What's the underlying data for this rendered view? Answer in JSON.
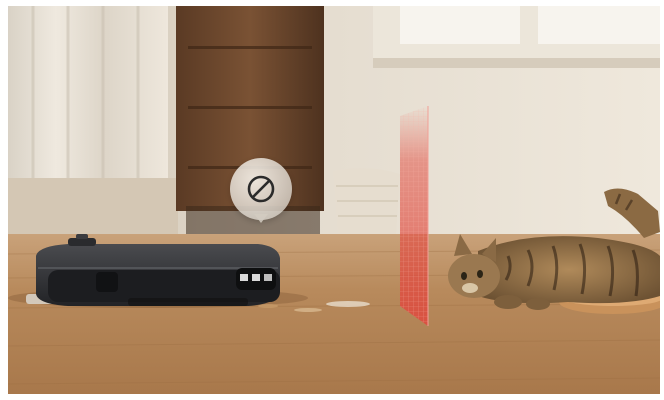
{
  "scene": {
    "subject": "robot-vacuum",
    "obstacle": "cat",
    "alert_icon": "no-entry-icon",
    "barrier_effect": "laser-scan-plane",
    "colors": {
      "floor": "#b98d62",
      "wall": "#e9e2d6",
      "robot_body": "#26272a",
      "laser": "#e2564a",
      "bubble": "#ece6dc"
    }
  }
}
